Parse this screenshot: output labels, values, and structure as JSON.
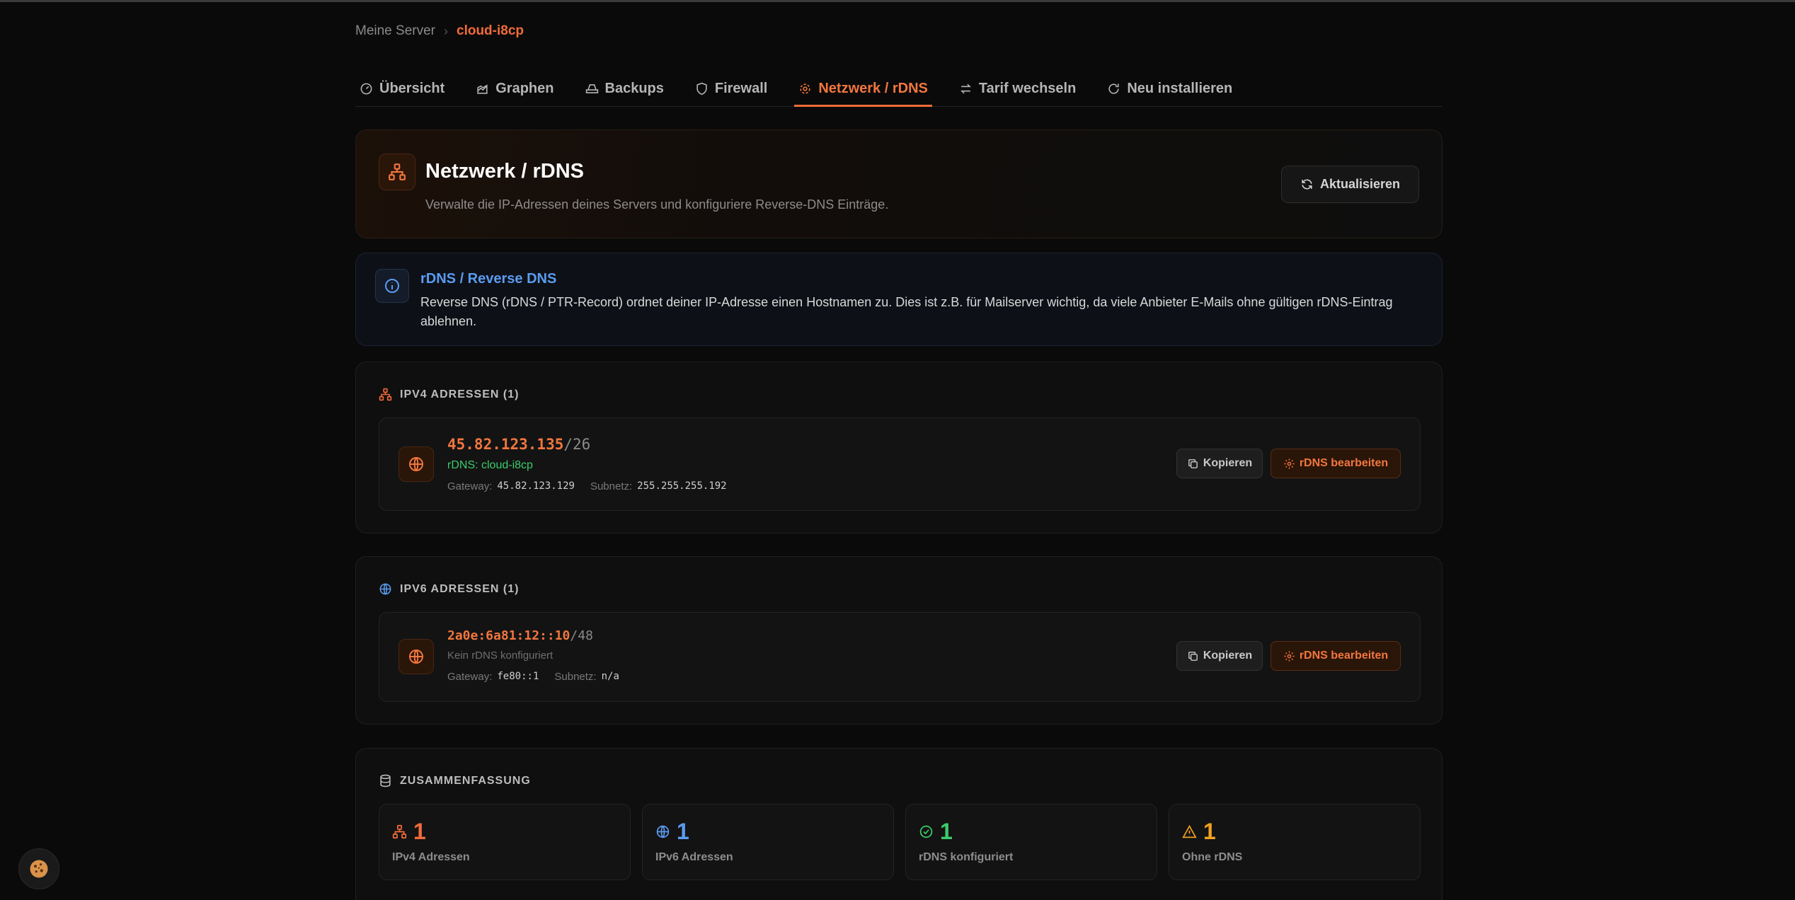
{
  "breadcrumb": {
    "parent": "Meine Server",
    "separator": "›",
    "current": "cloud-i8cp"
  },
  "tabs": [
    {
      "label": "Übersicht",
      "icon": "gauge-icon"
    },
    {
      "label": "Graphen",
      "icon": "chart-icon"
    },
    {
      "label": "Backups",
      "icon": "hard-drive-icon"
    },
    {
      "label": "Firewall",
      "icon": "shield-icon"
    },
    {
      "label": "Netzwerk / rDNS",
      "icon": "network-icon",
      "active": true
    },
    {
      "label": "Tarif wechseln",
      "icon": "swap-icon"
    },
    {
      "label": "Neu installieren",
      "icon": "refresh-icon"
    }
  ],
  "header": {
    "title": "Netzwerk / rDNS",
    "subtitle": "Verwalte die IP-Adressen deines Servers und konfiguriere Reverse-DNS Einträge.",
    "refresh_label": "Aktualisieren"
  },
  "info": {
    "title": "rDNS / Reverse DNS",
    "text": "Reverse DNS (rDNS / PTR-Record) ordnet deiner IP-Adresse einen Hostnamen zu. Dies ist z.B. für Mailserver wichtig, da viele Anbieter E-Mails ohne gültigen rDNS-Eintrag ablehnen."
  },
  "ipv4": {
    "section_title": "IPV4 ADRESSEN (1)",
    "addresses": [
      {
        "ip": "45.82.123.135",
        "prefix": "/26",
        "rdns": "rDNS: cloud-i8cp",
        "gateway_label": "Gateway:",
        "gateway": "45.82.123.129",
        "subnet_label": "Subnetz:",
        "subnet": "255.255.255.192",
        "copy_label": "Kopieren",
        "edit_label": "rDNS bearbeiten"
      }
    ]
  },
  "ipv6": {
    "section_title": "IPV6 ADRESSEN (1)",
    "addresses": [
      {
        "ip": "2a0e:6a81:12::10",
        "prefix": "/48",
        "rdns": "Kein rDNS konfiguriert",
        "gateway_label": "Gateway:",
        "gateway": "fe80::1",
        "subnet_label": "Subnetz:",
        "subnet": "n/a",
        "copy_label": "Kopieren",
        "edit_label": "rDNS bearbeiten"
      }
    ]
  },
  "summary": {
    "title": "ZUSAMMENFASSUNG",
    "stats": [
      {
        "value": "1",
        "label": "IPv4 Adressen",
        "icon": "network-icon",
        "color": "#f26b3a"
      },
      {
        "value": "1",
        "label": "IPv6 Adressen",
        "icon": "globe-icon",
        "color": "#5b9bf0"
      },
      {
        "value": "1",
        "label": "rDNS konfiguriert",
        "icon": "check-circle-icon",
        "color": "#3ccb6b"
      },
      {
        "value": "1",
        "label": "Ohne rDNS",
        "icon": "warning-icon",
        "color": "#f0a020"
      }
    ]
  },
  "colors": {
    "accent": "#f26b3a",
    "info": "#5b9bf0",
    "success": "#3ccb6b",
    "warning": "#f0a020"
  },
  "cookie_icon": "cookie-icon"
}
